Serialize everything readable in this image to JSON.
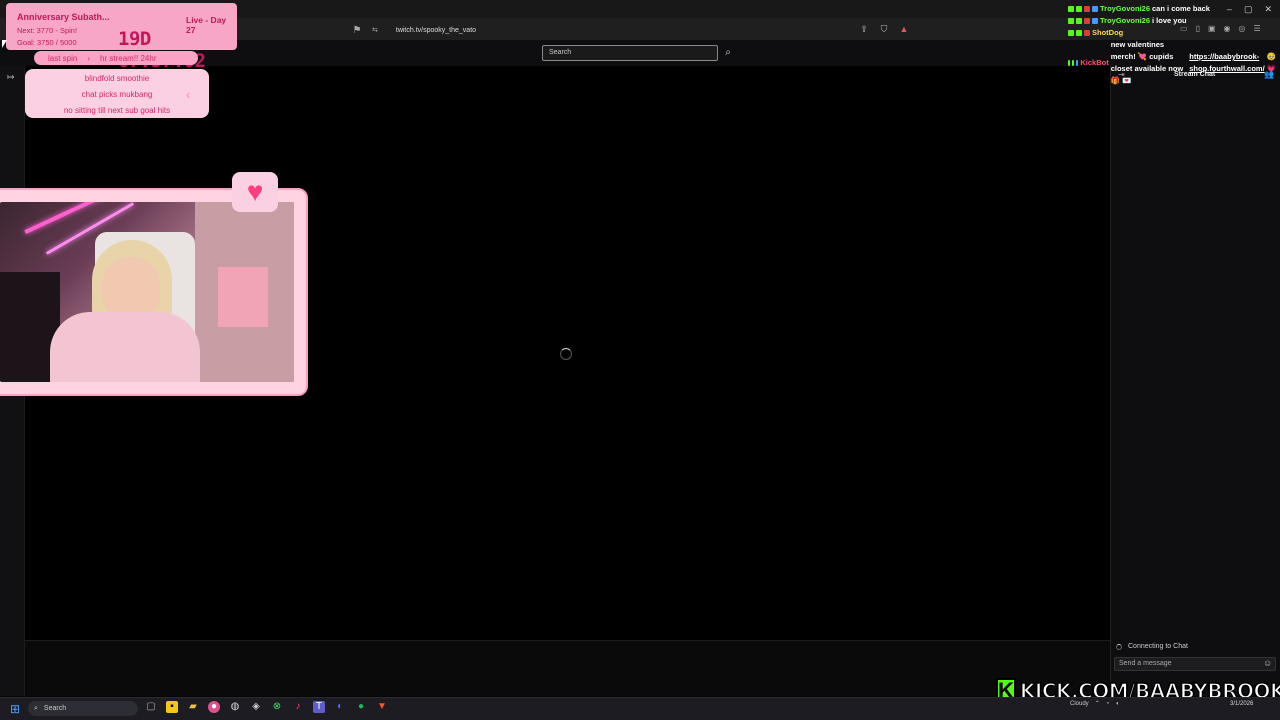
{
  "browser": {
    "url": "twitch.tv/spooky_the_vato",
    "window_buttons": [
      "–",
      "▢",
      "✕"
    ]
  },
  "twitch": {
    "search_placeholder": "Search",
    "chat_title": "Stream Chat",
    "chat_status": "Connecting to Chat",
    "chat_input_placeholder": "Send a message"
  },
  "overlay_chat": {
    "messages": [
      {
        "user": "TroyGovoni26",
        "user_color": "#6bff3f",
        "text": "can i come back"
      },
      {
        "user": "TroyGovoni26",
        "user_color": "#6bff3f",
        "text": "i love you"
      },
      {
        "user": "ShotDog",
        "user_color": "#ffd84a",
        "text": ""
      },
      {
        "user": "KickBot",
        "user_color": "#ff4b6b",
        "text": "new valentines merch! 💘 cupids closet available now 🎁 💌",
        "link": "https://baabybrook-shop.fourthwall.com/",
        "suffix": "🥹 💗"
      }
    ]
  },
  "subathon": {
    "title": "Anniversary Subath...",
    "next": "Next: 3770 - Spin!",
    "goal": "Goal: 3750 / 5000",
    "live_day": "Live - Day 27",
    "timer": "19D 07:57:02",
    "last_spin_label": "last spin",
    "last_spin_value": "hr stream!! 24hr",
    "spin_items": [
      "blindfold smoothie",
      "chat picks mukbang",
      "no sitting till next sub goal hits"
    ]
  },
  "kick_banner": {
    "letter": "K",
    "text": "KICK.COM/BAABYBROOK"
  },
  "taskbar": {
    "search_placeholder": "Search",
    "weather": "Cloudy",
    "date": "3/1/2026"
  },
  "colors": {
    "overlay_pink": "#f7a6c8",
    "overlay_text": "#c2185b",
    "kick_green": "#53fc18"
  }
}
